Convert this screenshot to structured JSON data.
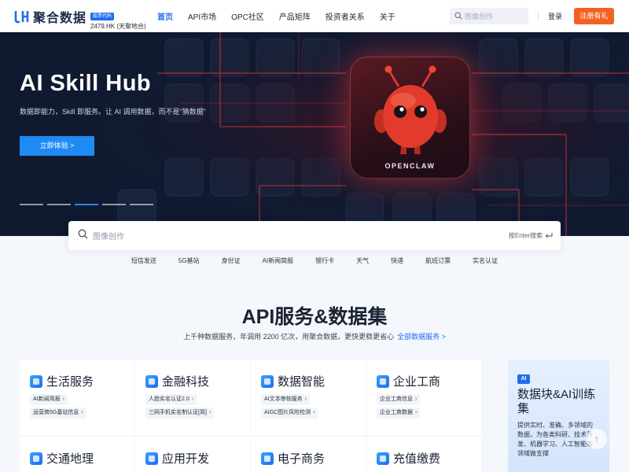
{
  "header": {
    "logo_text": "聚合数据",
    "stock_tag": "股票代码",
    "stock_code": "2479.HK (天聚地合)",
    "nav": [
      "首页",
      "API市场",
      "OPC社区",
      "产品矩阵",
      "投资者关系",
      "关于"
    ],
    "search_placeholder": "图像创作",
    "login": "登录",
    "register": "注册有礼"
  },
  "hero": {
    "title": "AI Skill Hub",
    "subtitle": "数据即能力，Skill 即服务。让 AI 调用数据，而不是\"猜数据\"",
    "cta": "立即体验 >",
    "card_label": "OPENCLAW",
    "slide_count": 5,
    "active_slide": 3
  },
  "search": {
    "placeholder": "图像创作",
    "enter_hint": "按Enter搜索",
    "tags": [
      "短信发送",
      "5G基站",
      "身份证",
      "AI新闻简报",
      "银行卡",
      "天气",
      "快递",
      "航班订票",
      "实名认证"
    ]
  },
  "section": {
    "title": "API服务&数据集",
    "subtitle": "上千种数据服务，年调用 2200 亿次，用聚合数据，更快更稳更省心",
    "link": "全部数据服务 >"
  },
  "categories": [
    {
      "title": "生活服务",
      "items": [
        "AI新闻简报",
        "运营商5G基站信息"
      ]
    },
    {
      "title": "金融科技",
      "items": [
        "人脸实名认证2.0",
        "三网手机实名制认证[简]"
      ]
    },
    {
      "title": "数据智能",
      "items": [
        "AI文本审核服务",
        "AIGC图片风险检测"
      ]
    },
    {
      "title": "企业工商",
      "items": [
        "企业工商信息",
        "企业工商数据"
      ]
    },
    {
      "title": "交通地理",
      "items": []
    },
    {
      "title": "应用开发",
      "items": []
    },
    {
      "title": "电子商务",
      "items": []
    },
    {
      "title": "充值缴费",
      "items": []
    }
  ],
  "side_card": {
    "badge": "AI",
    "title": "数据块&AI训练集",
    "desc": "提供实时、准确、多领域的数据，为各类科研、技术开发、机器学习、人工智能等领域做支撑"
  },
  "colors": {
    "brand": "#1e6cf0",
    "cta": "#f26222",
    "hero_bg": "#0d1830",
    "robot": "#e23a2c"
  }
}
